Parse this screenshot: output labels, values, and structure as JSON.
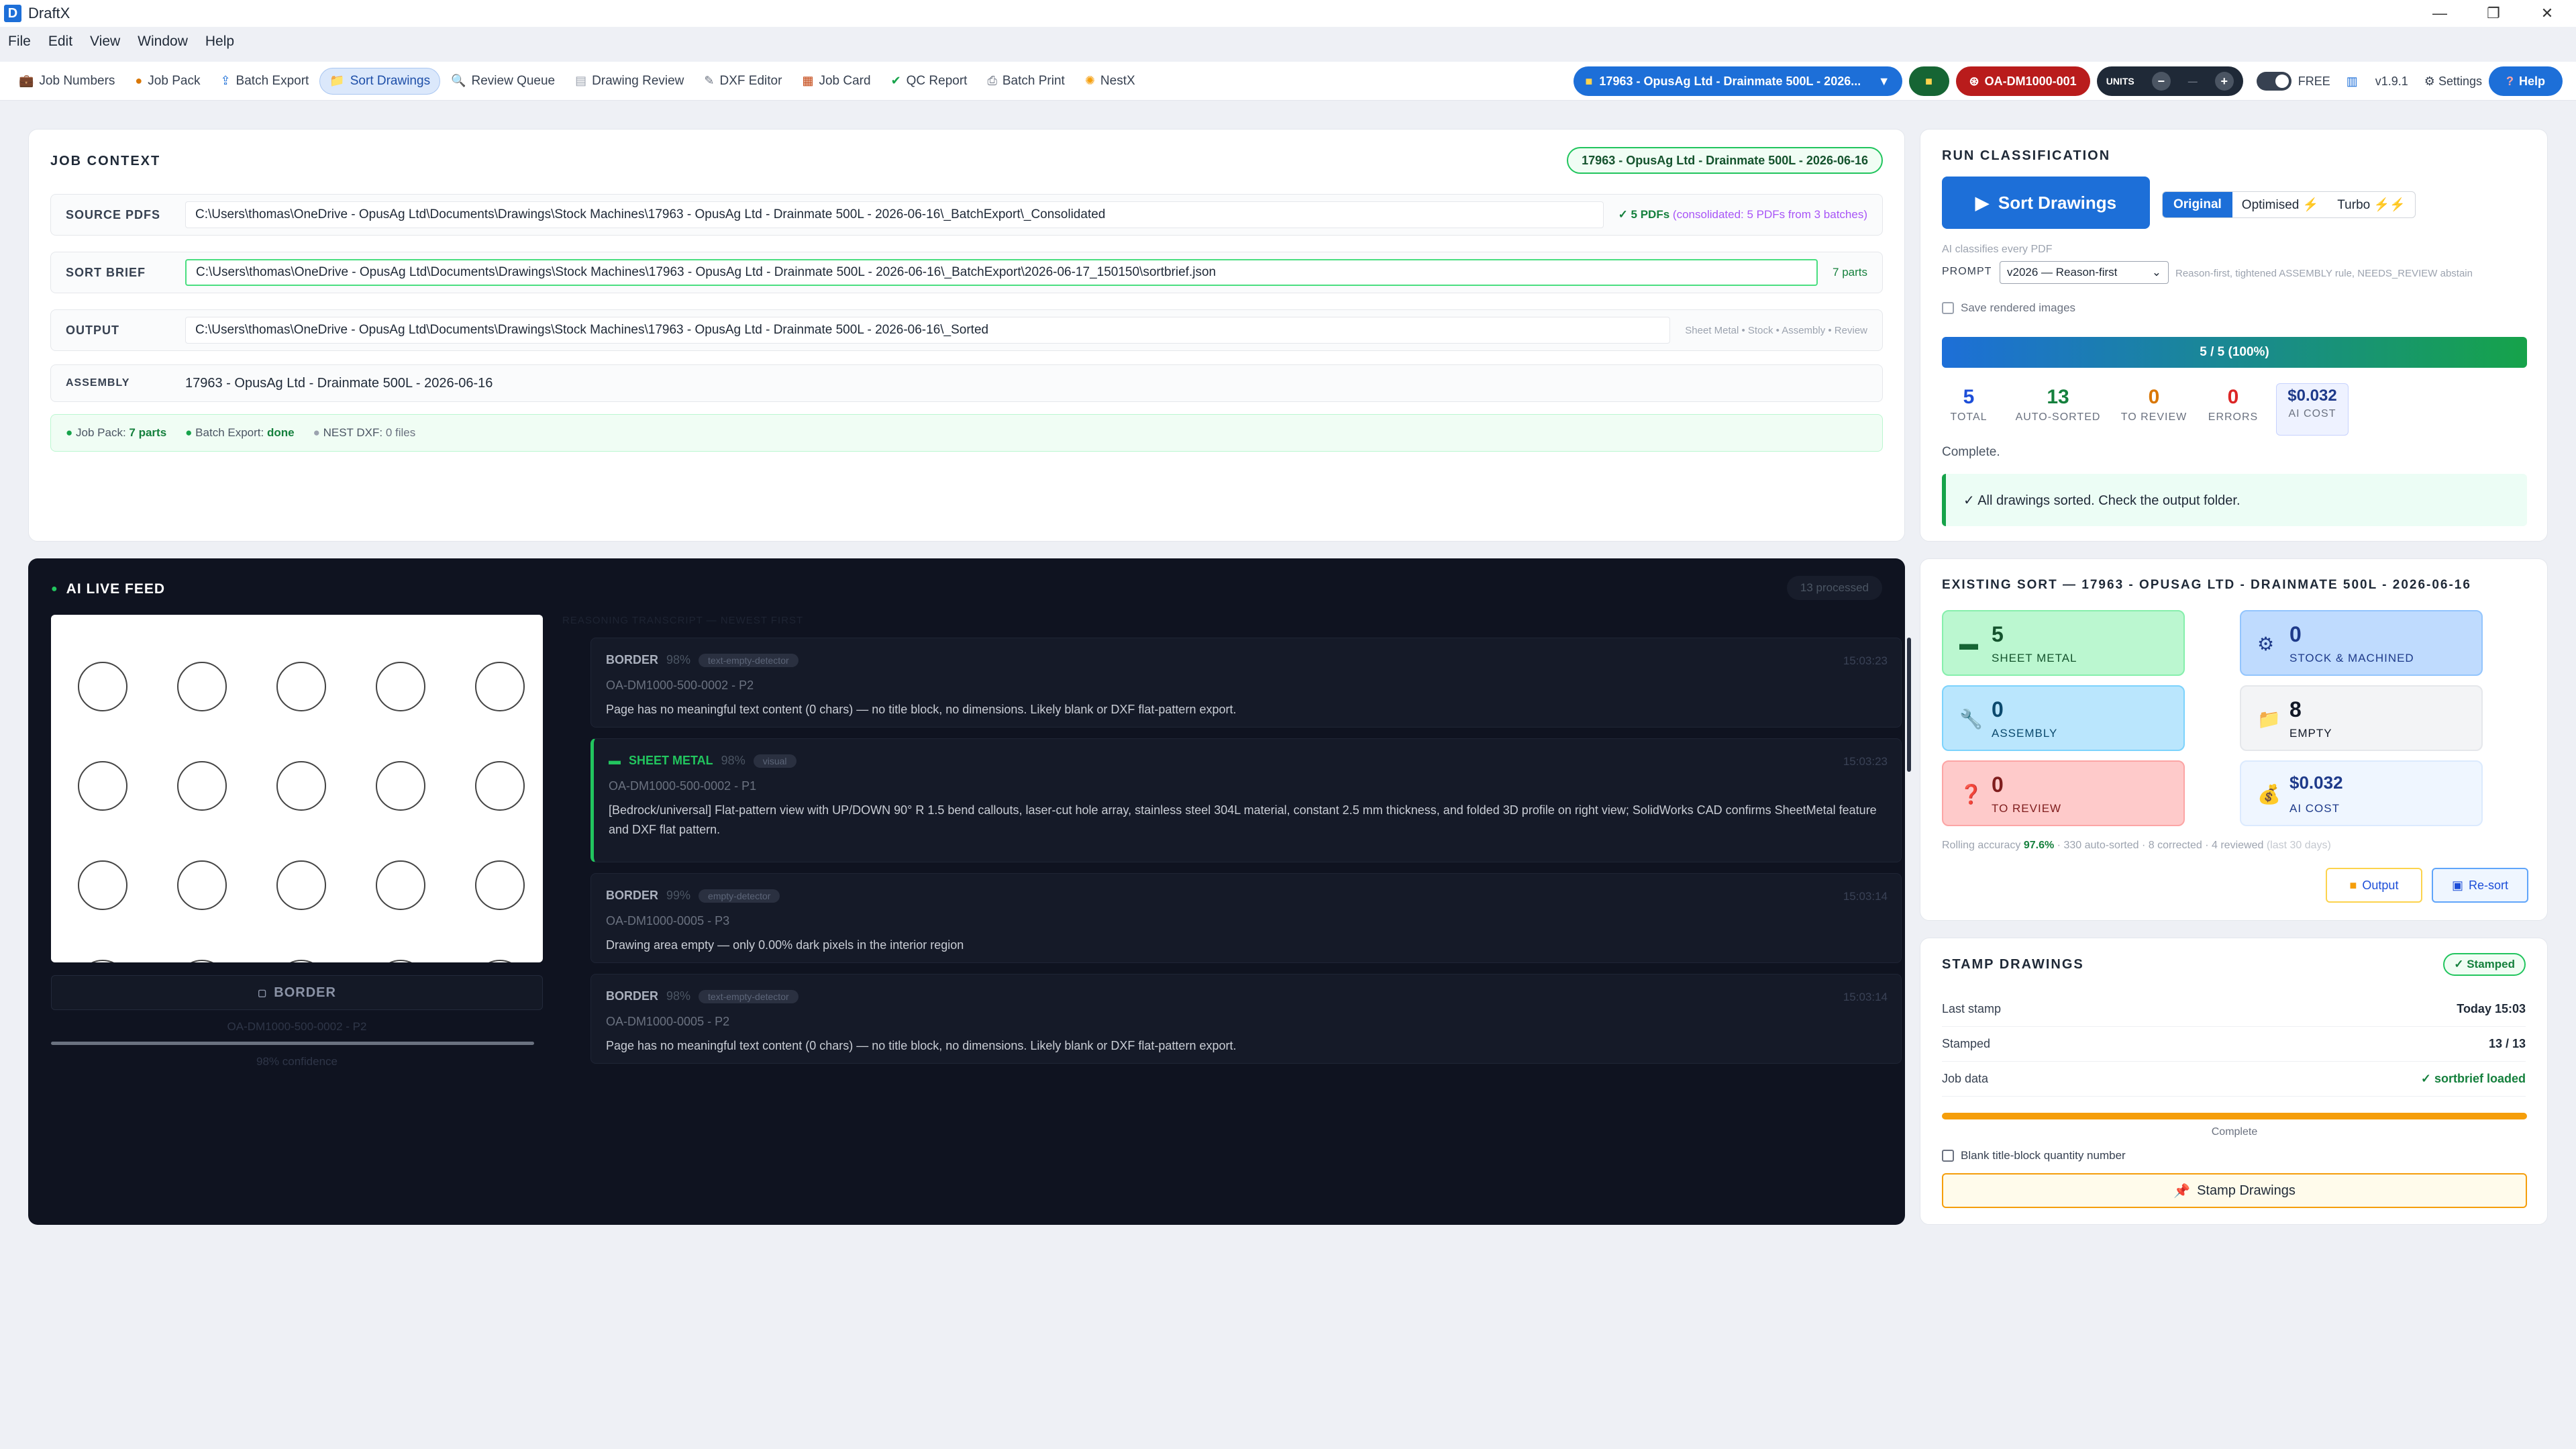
{
  "app": {
    "title": "DraftX",
    "icon_letter": "D"
  },
  "window": {
    "minimize": "—",
    "maximize": "❐",
    "close": "✕"
  },
  "menu": [
    "File",
    "Edit",
    "View",
    "Window",
    "Help"
  ],
  "nav": [
    {
      "label": "Job Numbers",
      "icon": "briefcase-icon",
      "glyph": "💼"
    },
    {
      "label": "Job Pack",
      "icon": "pack-icon",
      "glyph": "●"
    },
    {
      "label": "Batch Export",
      "icon": "export-icon",
      "glyph": "⇪"
    },
    {
      "label": "Sort Drawings",
      "icon": "folder-icon",
      "glyph": "📁"
    },
    {
      "label": "Review Queue",
      "icon": "magnifier-icon",
      "glyph": "🔍"
    },
    {
      "label": "Drawing Review",
      "icon": "document-icon",
      "glyph": "▤"
    },
    {
      "label": "DXF Editor",
      "icon": "pencil-icon",
      "glyph": "✎"
    },
    {
      "label": "Job Card",
      "icon": "clipboard-icon",
      "glyph": "▦"
    },
    {
      "label": "QC Report",
      "icon": "check-icon",
      "glyph": "✔"
    },
    {
      "label": "Batch Print",
      "icon": "printer-icon",
      "glyph": "⎙"
    },
    {
      "label": "NestX",
      "icon": "nest-icon",
      "glyph": "✺"
    }
  ],
  "toolbar": {
    "job_selector": "17963 - OpusAg Ltd - Drainmate 500L - 2026...",
    "drawing_code": "OA-DM1000-001",
    "units_label": "UNITS",
    "units_minus": "−",
    "units_value": "—",
    "units_plus": "+",
    "mode": "FREE",
    "version": "v1.9.1",
    "settings": "Settings",
    "help": "Help"
  },
  "job_context": {
    "title": "JOB CONTEXT",
    "badge": "17963 - OpusAg Ltd - Drainmate 500L - 2026-06-16",
    "source_label": "SOURCE PDFS",
    "source_path": "C:\\Users\\thomas\\OneDrive - OpusAg Ltd\\Documents\\Drawings\\Stock Machines\\17963 - OpusAg Ltd - Drainmate 500L - 2026-06-16\\_BatchExport\\_Consolidated",
    "source_count": "✓ 5 PDFs",
    "source_note": "(consolidated: 5 PDFs from 3 batches)",
    "brief_label": "SORT BRIEF",
    "brief_path": "C:\\Users\\thomas\\OneDrive - OpusAg Ltd\\Documents\\Drawings\\Stock Machines\\17963 - OpusAg Ltd - Drainmate 500L - 2026-06-16\\_BatchExport\\2026-06-17_150150\\sortbrief.json",
    "brief_parts": "7 parts",
    "output_label": "OUTPUT",
    "output_path": "C:\\Users\\thomas\\OneDrive - OpusAg Ltd\\Documents\\Drawings\\Stock Machines\\17963 - OpusAg Ltd - Drainmate 500L - 2026-06-16\\_Sorted",
    "output_note": "Sheet Metal • Stock • Assembly • Review",
    "assembly_label": "ASSEMBLY",
    "assembly_value": "17963 - OpusAg Ltd - Drainmate 500L - 2026-06-16",
    "status_jobpack": "Job Pack:",
    "status_jobpack_val": "7 parts",
    "status_batch": "Batch Export:",
    "status_batch_val": "done",
    "status_nest": "NEST DXF:",
    "status_nest_val": "0 files"
  },
  "run": {
    "title": "RUN CLASSIFICATION",
    "sort_button": "Sort Drawings",
    "modes": [
      "Original",
      "Optimised",
      "Turbo"
    ],
    "active_mode": "Original",
    "hint": "AI classifies every PDF",
    "prompt_label": "PROMPT",
    "prompt_value": "v2026 — Reason-first",
    "prompt_note": "Reason-first, tightened ASSEMBLY rule, NEEDS_REVIEW abstain",
    "save_images": "Save rendered images",
    "progress_text": "5 / 5 (100%)",
    "progress_fraction": 1.0,
    "stats": [
      {
        "value": "5",
        "label": "TOTAL",
        "color": "#1d4ed8"
      },
      {
        "value": "13",
        "label": "AUTO-SORTED",
        "color": "#15803d"
      },
      {
        "value": "0",
        "label": "TO REVIEW",
        "color": "#d97706"
      },
      {
        "value": "0",
        "label": "ERRORS",
        "color": "#dc2626"
      },
      {
        "value": "$0.032",
        "label": "AI COST",
        "color": "#1e3a8a"
      }
    ],
    "status": "Complete.",
    "message": "✓ All drawings sorted. Check the output folder."
  },
  "feed": {
    "title": "AI LIVE FEED",
    "processed": "13 processed",
    "transcript_header": "REASONING TRANSCRIPT — NEWEST FIRST",
    "preview_label": "BORDER",
    "preview_id": "OA-DM1000-500-0002 - P2",
    "preview_confidence": "98% confidence",
    "items": [
      {
        "tag": "BORDER",
        "pct": "98%",
        "chip": "text-empty-detector",
        "time": "15:03:23",
        "id": "OA-DM1000-500-0002 - P2",
        "text": "Page has no meaningful text content (0 chars) — no title block, no dimensions. Likely blank or DXF flat-pattern export.",
        "accent": "#3a4256",
        "tagcolor": "#aab0bd"
      },
      {
        "tag": "SHEET METAL",
        "pct": "98%",
        "chip": "visual",
        "time": "15:03:23",
        "id": "OA-DM1000-500-0002 - P1",
        "text": "[Bedrock/universal] Flat-pattern view with UP/DOWN 90° R 1.5 bend callouts, laser-cut hole array, stainless steel 304L material, constant 2.5 mm thickness, and folded 3D profile on right view; SolidWorks CAD confirms SheetMetal feature and DXF flat pattern.",
        "accent": "#22c55e",
        "tagcolor": "#22c55e"
      },
      {
        "tag": "BORDER",
        "pct": "99%",
        "chip": "empty-detector",
        "time": "15:03:14",
        "id": "OA-DM1000-0005 - P3",
        "text": "Drawing area empty — only 0.00% dark pixels in the interior region",
        "accent": "#3a4256",
        "tagcolor": "#aab0bd"
      },
      {
        "tag": "BORDER",
        "pct": "98%",
        "chip": "text-empty-detector",
        "time": "15:03:14",
        "id": "OA-DM1000-0005 - P2",
        "text": "Page has no meaningful text content (0 chars) — no title block, no dimensions. Likely blank or DXF flat-pattern export.",
        "accent": "#3a4256",
        "tagcolor": "#aab0bd"
      }
    ]
  },
  "existing": {
    "title": "EXISTING SORT — 17963 - OPUSAG LTD - DRAINMATE 500L - 2026-06-16",
    "tiles": [
      {
        "value": "5",
        "label": "SHEET METAL",
        "icon": "sheet-icon",
        "glyph": "▬",
        "bg": "#bbf7d0",
        "border": "#86efac",
        "fg": "#14532d",
        "icolor": "#166534"
      },
      {
        "value": "0",
        "label": "STOCK & MACHINED",
        "icon": "gear-icon",
        "glyph": "⚙",
        "bg": "#bfdbfe",
        "border": "#93c5fd",
        "fg": "#1e3a8a",
        "icolor": "#1e3a8a"
      },
      {
        "value": "0",
        "label": "ASSEMBLY",
        "icon": "wrench-icon",
        "glyph": "🔧",
        "bg": "#bae6fd",
        "border": "#7dd3fc",
        "fg": "#0c4a6e",
        "icolor": "#0c4a6e"
      },
      {
        "value": "8",
        "label": "EMPTY",
        "icon": "folder-icon",
        "glyph": "📁",
        "bg": "#f3f4f6",
        "border": "#e5e7eb",
        "fg": "#111827",
        "icolor": "#ca8a04"
      },
      {
        "value": "0",
        "label": "TO REVIEW",
        "icon": "question-icon",
        "glyph": "❓",
        "bg": "#fecaca",
        "border": "#fca5a5",
        "fg": "#7f1d1d",
        "icolor": "#dc2626"
      },
      {
        "value": "$0.032",
        "label": "AI COST",
        "icon": "moneybag-icon",
        "glyph": "💰",
        "bg": "#eff6ff",
        "border": "#dbeafe",
        "fg": "#1e3a8a",
        "icolor": "#b45309"
      }
    ],
    "accuracy_prefix": "Rolling accuracy",
    "accuracy_value": "97.6%",
    "accuracy_suffix": "· 330 auto-sorted · 8 corrected · 4 reviewed",
    "accuracy_window": "(last 30 days)",
    "output_button": "Output",
    "resort_button": "Re-sort"
  },
  "stamp": {
    "title": "STAMP DRAWINGS",
    "badge": "✓ Stamped",
    "rows": [
      {
        "k": "Last stamp",
        "v": "Today 15:03",
        "color": "#111827"
      },
      {
        "k": "Stamped",
        "v": "13 / 13",
        "color": "#111827"
      },
      {
        "k": "Job data",
        "v": "✓ sortbrief loaded",
        "color": "#15803d"
      }
    ],
    "progress_fraction": 1.0,
    "progress_label": "Complete",
    "blank_qty": "Blank title-block quantity number",
    "button": "Stamp Drawings"
  },
  "colors": {
    "accent": "#1d6fd8",
    "success": "#16a34a",
    "feed_bg": "#0f1320"
  }
}
